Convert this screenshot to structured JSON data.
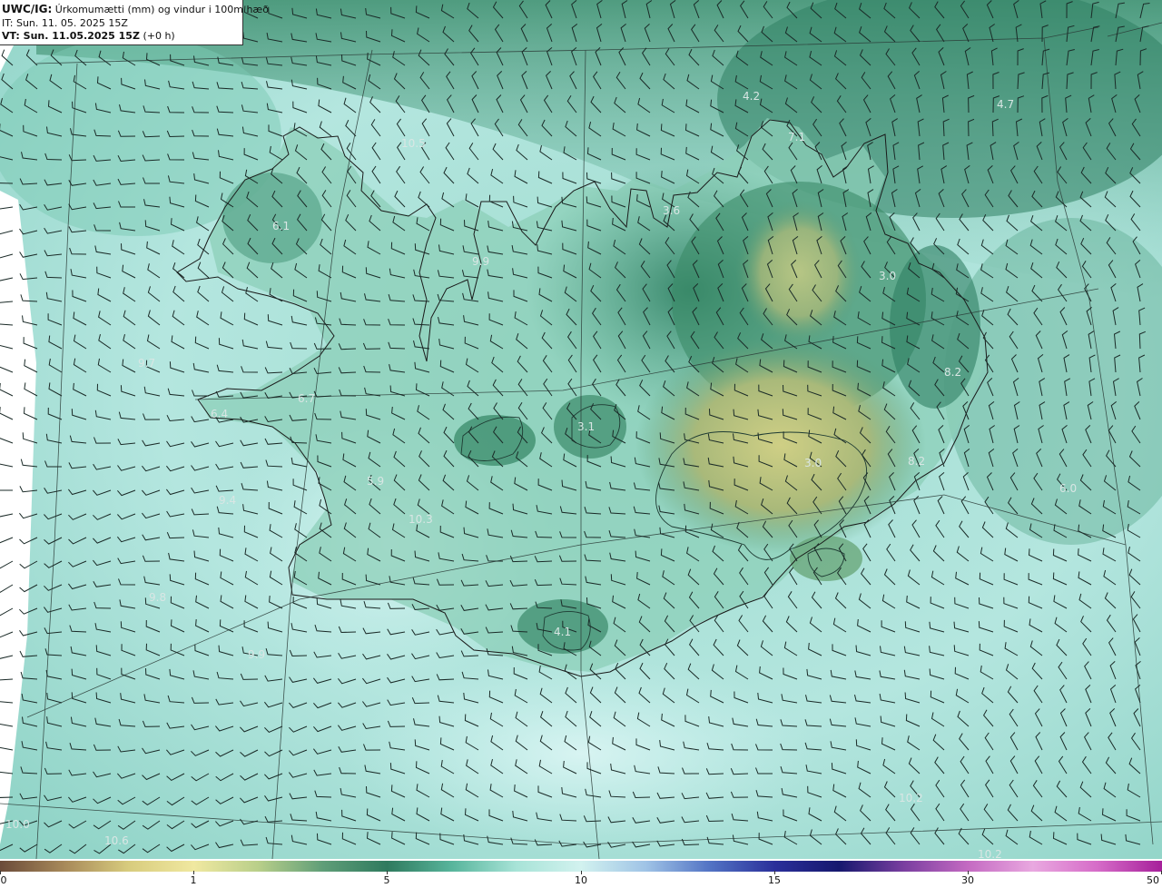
{
  "header": {
    "model_prefix": "UWC/IG:",
    "title": "Úrkomumætti (mm) og vindur i 100m hæð",
    "init_time": "IT: Sun. 11. 05. 2025 15Z",
    "valid_prefix": "VT: Sun. 11.05.2025 15Z",
    "valid_offset": "(+0 h)"
  },
  "map": {
    "colors": {
      "sea_light": "#bfeceb",
      "sea_mid": "#86cfc3",
      "land_green": "#3f8e6e",
      "land_dark": "#2f7a60",
      "highland_yellow": "#c9c77a",
      "coastline": "#1a1a1a"
    },
    "value_labels": [
      "4.2",
      "4.7",
      "7.1",
      "10.5",
      "3.6",
      "6.1",
      "9.9",
      "3.0",
      "9.7",
      "8.2",
      "6.7",
      "3.1",
      "6.4",
      "8.2",
      "6.0",
      "5.9",
      "3.0",
      "9.4",
      "10.3",
      "9.8",
      "4.1",
      "9.9",
      "10.2",
      "10.0",
      "10.2",
      "10.6"
    ]
  },
  "colorbar": {
    "ticks": [
      "0",
      "1",
      "5",
      "10",
      "15",
      "30",
      "50"
    ],
    "colors": [
      "#6b4b3a",
      "#a88a5a",
      "#d8cc7e",
      "#f0e8a0",
      "#b9cf8a",
      "#5f9e78",
      "#2f7a5e",
      "#58b59c",
      "#a7e3d7",
      "#d2f2ef",
      "#9fc3e6",
      "#5273c4",
      "#2a2f9a",
      "#16186e",
      "#7a3fa0",
      "#c46ac2",
      "#e9a8e0",
      "#d66cc8",
      "#a6209a"
    ]
  }
}
